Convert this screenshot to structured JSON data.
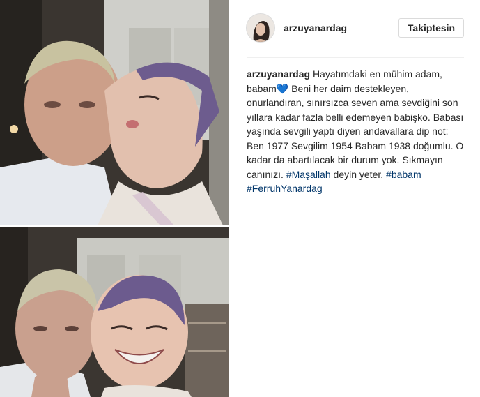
{
  "post": {
    "username": "arzuyanardag",
    "follow_label": "Takiptesin",
    "caption": {
      "username": "arzuyanardag",
      "text_1": "Hayatımdaki en mühim adam, babam",
      "heart": "💙",
      "text_2": " Beni her daim destekleyen, onurlandıran, sınırsızca seven ama sevdiğini son yıllara kadar fazla belli edemeyen babişko. Babası yaşında sevgili yaptı diyen andavallara dip not: Ben 1977 Sevgilim 1954 Babam 1938 doğumlu. O kadar da abartılacak bir durum yok. Sıkmayın canınızı.",
      "hashtag_1": "#Maşallah",
      "text_3": "deyin yeter.",
      "hashtag_2": "#babam",
      "hashtag_3": "#FerruhYanardag"
    }
  },
  "colors": {
    "link": "#003569",
    "heart": "#3b8fe0",
    "text": "#262626",
    "border": "#dbdbdb"
  },
  "icons": {
    "heart": "blue-heart-emoji"
  }
}
